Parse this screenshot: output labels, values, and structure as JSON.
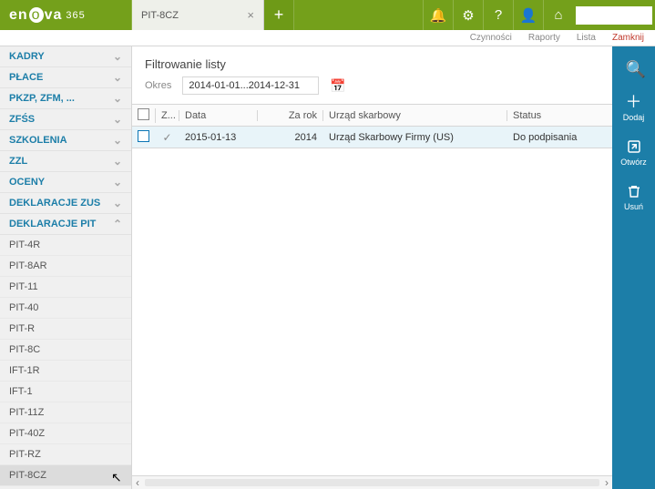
{
  "app": {
    "logo_pre": "en",
    "logo_accent": "o",
    "logo_post": "va",
    "logo_suffix": "365"
  },
  "tab": {
    "title": "PIT-8CZ"
  },
  "sublinks": {
    "a": "Czynności",
    "b": "Raporty",
    "c": "Lista",
    "d": "Zamknij"
  },
  "sidebar": {
    "groups": [
      {
        "label": "KADRY"
      },
      {
        "label": "PŁACE"
      },
      {
        "label": "PKZP, ZFM, ..."
      },
      {
        "label": "ZFŚS"
      },
      {
        "label": "SZKOLENIA"
      },
      {
        "label": "ZZL"
      },
      {
        "label": "OCENY"
      },
      {
        "label": "DEKLARACJE ZUS"
      },
      {
        "label": "DEKLARACJE PIT"
      }
    ],
    "items": [
      "PIT-4R",
      "PIT-8AR",
      "PIT-11",
      "PIT-40",
      "PIT-R",
      "PIT-8C",
      "IFT-1R",
      "IFT-1",
      "PIT-11Z",
      "PIT-40Z",
      "PIT-RZ",
      "PIT-8CZ"
    ]
  },
  "filter": {
    "title": "Filtrowanie listy",
    "okres_label": "Okres",
    "okres_value": "2014-01-01...2014-12-31"
  },
  "columns": {
    "z": "Z...",
    "data": "Data",
    "rok": "Za rok",
    "urzad": "Urząd skarbowy",
    "status": "Status"
  },
  "rows": [
    {
      "data": "2015-01-13",
      "rok": "2014",
      "urzad": "Urząd Skarbowy Firmy (US)",
      "status": "Do podpisania"
    }
  ],
  "actions": {
    "dodaj": "Dodaj",
    "otworz": "Otwórz",
    "usun": "Usuń"
  }
}
